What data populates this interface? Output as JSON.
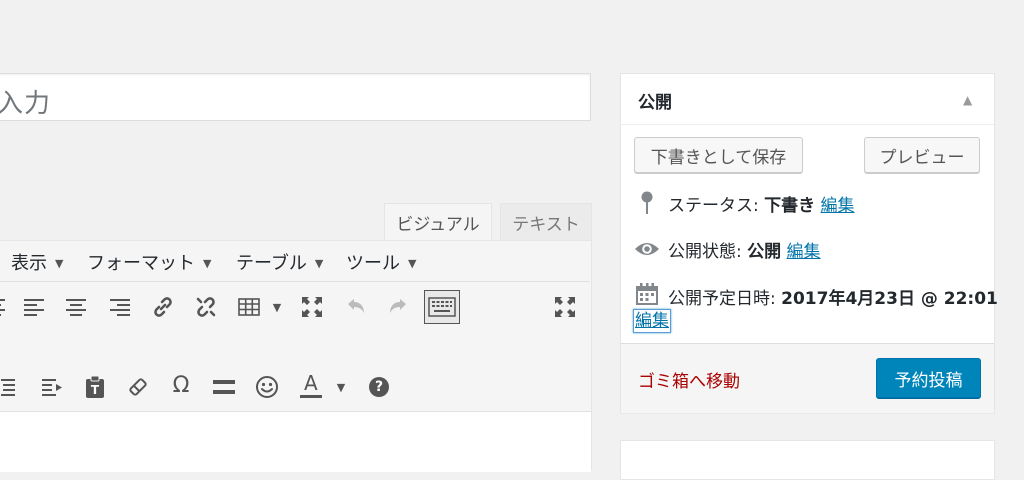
{
  "title_field": {
    "value": "入力"
  },
  "editor": {
    "tabs": [
      {
        "label": "ビジュアル"
      },
      {
        "label": "テキスト"
      }
    ],
    "menus": [
      {
        "label": "表示"
      },
      {
        "label": "フォーマット"
      },
      {
        "label": "テーブル"
      },
      {
        "label": "ツール"
      }
    ],
    "omega_symbol": "Ω",
    "text_color_letter": "A",
    "help_symbol": "?"
  },
  "publish": {
    "title": "公開",
    "save_draft_label": "下書きとして保存",
    "preview_label": "プレビュー",
    "status_label": "ステータス:",
    "status_value": "下書き",
    "visibility_label": "公開状態:",
    "visibility_value": "公開",
    "schedule_label": "公開予定日時:",
    "schedule_value": "2017年4月23日 @ 22:01",
    "edit_label": "編集",
    "trash_label": "ゴミ箱へ移動",
    "publish_label": "予約投稿",
    "accent_color": "#0085ba",
    "trash_color": "#aa0000"
  },
  "icons": {
    "align": "align-icon",
    "link": "link-icon",
    "unlink": "unlink-icon",
    "table": "table-icon",
    "fullscreen": "fullscreen-icon",
    "undo": "undo-icon",
    "redo": "redo-icon",
    "keyboard": "keyboard-icon",
    "pin": "pin-icon",
    "eye": "eye-icon",
    "calendar": "calendar-icon"
  }
}
